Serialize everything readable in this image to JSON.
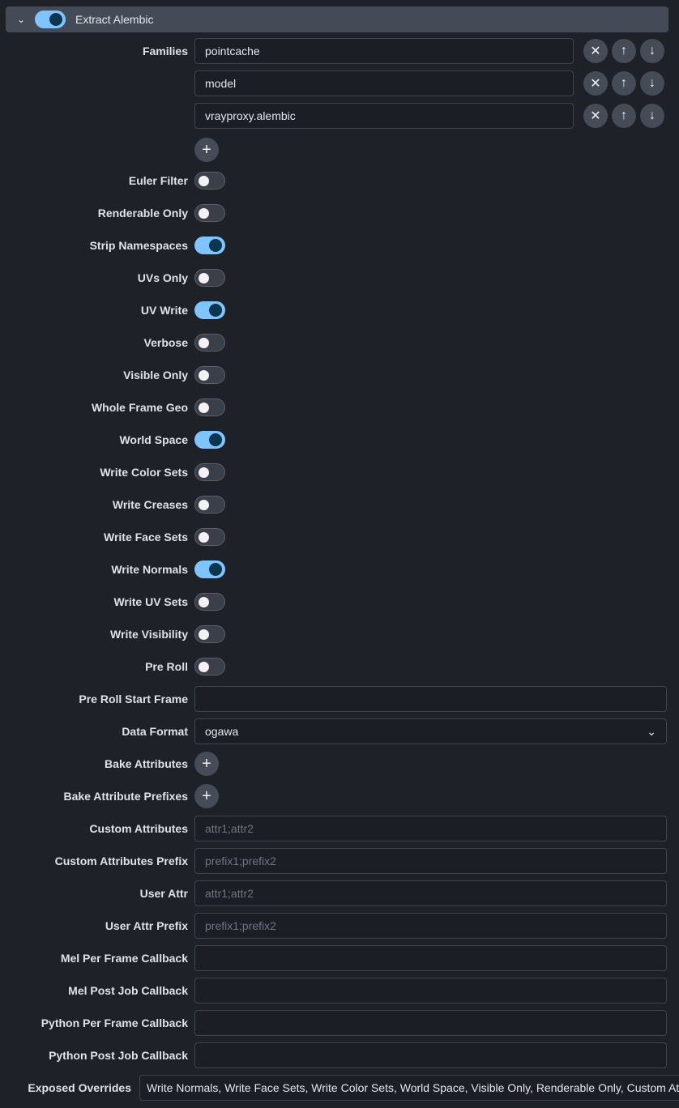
{
  "header": {
    "title": "Extract Alembic",
    "enabled": true,
    "chevron_icon": "chevron-down-icon"
  },
  "families": {
    "label": "Families",
    "items": [
      "pointcache",
      "model",
      "vrayproxy.alembic"
    ],
    "remove_icon": "close-icon",
    "up_icon": "arrow-up-icon",
    "down_icon": "arrow-down-icon",
    "add_icon": "plus-icon"
  },
  "toggles": [
    {
      "label": "Euler Filter",
      "on": false
    },
    {
      "label": "Renderable Only",
      "on": false
    },
    {
      "label": "Strip Namespaces",
      "on": true
    },
    {
      "label": "UVs Only",
      "on": false
    },
    {
      "label": "UV Write",
      "on": true
    },
    {
      "label": "Verbose",
      "on": false
    },
    {
      "label": "Visible Only",
      "on": false
    },
    {
      "label": "Whole Frame Geo",
      "on": false
    },
    {
      "label": "World Space",
      "on": true
    },
    {
      "label": "Write Color Sets",
      "on": false
    },
    {
      "label": "Write Creases",
      "on": false
    },
    {
      "label": "Write Face Sets",
      "on": false
    },
    {
      "label": "Write Normals",
      "on": true
    },
    {
      "label": "Write UV Sets",
      "on": false
    },
    {
      "label": "Write Visibility",
      "on": false
    },
    {
      "label": "Pre Roll",
      "on": false
    }
  ],
  "fields": [
    {
      "label": "Pre Roll Start Frame",
      "type": "text",
      "value": "",
      "placeholder": ""
    },
    {
      "label": "Data Format",
      "type": "select",
      "value": "ogawa"
    },
    {
      "label": "Bake Attributes",
      "type": "add"
    },
    {
      "label": "Bake Attribute Prefixes",
      "type": "add"
    },
    {
      "label": "Custom Attributes",
      "type": "text",
      "value": "",
      "placeholder": "attr1;attr2"
    },
    {
      "label": "Custom Attributes Prefix",
      "type": "text",
      "value": "",
      "placeholder": "prefix1;prefix2"
    },
    {
      "label": "User Attr",
      "type": "text",
      "value": "",
      "placeholder": "attr1;attr2"
    },
    {
      "label": "User Attr Prefix",
      "type": "text",
      "value": "",
      "placeholder": "prefix1;prefix2"
    },
    {
      "label": "Mel Per Frame Callback",
      "type": "text",
      "value": "",
      "placeholder": ""
    },
    {
      "label": "Mel Post Job Callback",
      "type": "text",
      "value": "",
      "placeholder": ""
    },
    {
      "label": "Python Per Frame Callback",
      "type": "text",
      "value": "",
      "placeholder": ""
    },
    {
      "label": "Python Post Job Callback",
      "type": "text",
      "value": "",
      "placeholder": ""
    }
  ],
  "exposed_overrides": {
    "label": "Exposed Overrides",
    "value": "Write Normals, Write Face Sets, Write Color Sets, World Space, Visible Only, Renderable Only, Custom Attributes"
  },
  "colors": {
    "accent": "#7ec5ff",
    "background": "#1e2127",
    "header": "#444b57"
  }
}
